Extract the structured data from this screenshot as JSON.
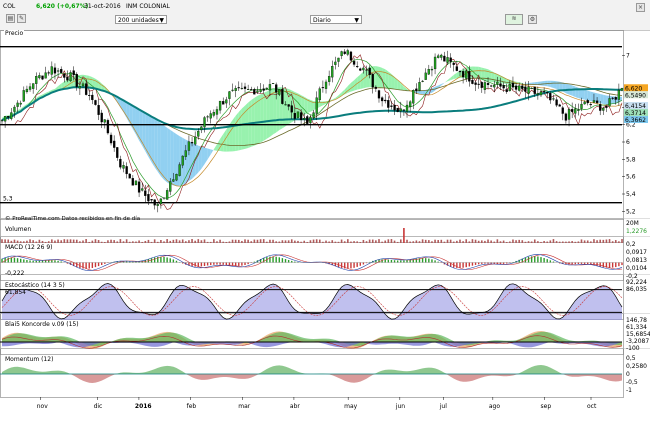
{
  "toolbar": {
    "symbol": "COL",
    "price_change": "6,620 (+0,67%)",
    "date": "31-oct-2016",
    "name": "INM COLONIAL",
    "bars_select": "200 unidades",
    "period_select": "Diario"
  },
  "colors": {
    "up_candle": "#1fa01f",
    "down_candle": "#000000",
    "long_ma": "#0a7d7d",
    "cloud_bull": "#86f0a0",
    "cloud_bear": "#7ec8ee",
    "hist_pos": "#2a9b2a",
    "hist_neg": "#c83737",
    "accent": "#00a000"
  },
  "chart_data": [
    {
      "type": "candlestick",
      "panel": "precio",
      "title": "Precio",
      "source_note": "© ProRealTime.com  Datos recibidos en fin de día",
      "y_ticks": [
        5.2,
        5.4,
        5.6,
        5.8,
        6,
        6.2,
        6.4,
        7
      ],
      "y_tick_labels": [
        "5,2",
        "5,4",
        "5,6",
        "5,8",
        "6",
        "6,2",
        "6,4",
        "7"
      ],
      "right_labels": [
        "6,620",
        "6,5490",
        "6,4154",
        "6,3714",
        "6,3662"
      ],
      "hlines": [
        7.1,
        6.2,
        5.3
      ],
      "hline_labels": [
        "",
        "",
        "5,3"
      ],
      "ylim": [
        5.1,
        7.2
      ],
      "x_ticks": [
        "nov",
        "dic",
        "2016",
        "feb",
        "mar",
        "abr",
        "may",
        "jun",
        "jul",
        "ago",
        "sep",
        "oct"
      ],
      "close_keypoints": [
        [
          0,
          6.25
        ],
        [
          5,
          6.45
        ],
        [
          10,
          6.7
        ],
        [
          16,
          6.85
        ],
        [
          22,
          6.75
        ],
        [
          28,
          6.55
        ],
        [
          33,
          6.2
        ],
        [
          38,
          5.75
        ],
        [
          44,
          5.45
        ],
        [
          50,
          5.25
        ],
        [
          54,
          5.55
        ],
        [
          60,
          5.95
        ],
        [
          66,
          6.3
        ],
        [
          73,
          6.55
        ],
        [
          80,
          6.6
        ],
        [
          87,
          6.65
        ],
        [
          93,
          6.35
        ],
        [
          98,
          6.2
        ],
        [
          104,
          6.75
        ],
        [
          110,
          7.05
        ],
        [
          116,
          6.85
        ],
        [
          122,
          6.5
        ],
        [
          128,
          6.35
        ],
        [
          134,
          6.7
        ],
        [
          140,
          7.0
        ],
        [
          146,
          6.85
        ],
        [
          152,
          6.7
        ],
        [
          158,
          6.65
        ],
        [
          166,
          6.6
        ],
        [
          174,
          6.55
        ],
        [
          181,
          6.3
        ],
        [
          188,
          6.45
        ],
        [
          194,
          6.4
        ],
        [
          199,
          6.62
        ]
      ]
    },
    {
      "type": "bar",
      "panel": "volumen",
      "title": "Volumen",
      "y_tick_labels": [
        "20M",
        "1,2276"
      ]
    },
    {
      "type": "line",
      "panel": "macd",
      "title": "MACD (12 26 9)",
      "y_tick_labels": [
        "0,2",
        "0,0917",
        "0,0813",
        "0,0104",
        "-0,2"
      ],
      "note": "-0,222"
    },
    {
      "type": "line",
      "panel": "estocastico",
      "title": "Estocástico (14 3 5)",
      "y_tick_labels": [
        "92,224",
        "86,035"
      ],
      "note": "61,854"
    },
    {
      "type": "area",
      "panel": "blai5",
      "title": "Blai5 Koncorde v.09 (15)",
      "y_tick_labels": [
        "146,78",
        "61,334",
        "15,6854",
        "-3,2087",
        "-100"
      ]
    },
    {
      "type": "area",
      "panel": "momentum",
      "title": "Momentum (12)",
      "y_tick_labels": [
        "0,5",
        "0,2580",
        "0",
        "-0,5",
        "-1"
      ]
    }
  ]
}
